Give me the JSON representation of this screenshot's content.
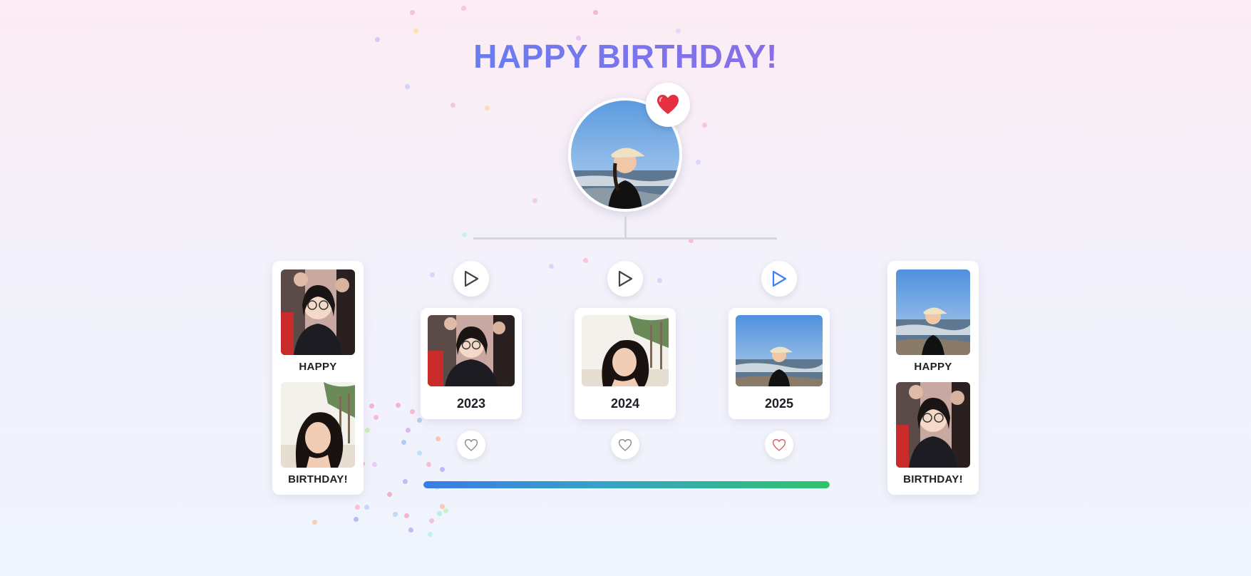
{
  "title": "HAPPY BIRTHDAY!",
  "colors": {
    "title_start": "#6a7cf0",
    "title_end": "#8a6ee6",
    "heart": "#e53040",
    "progress_start": "#3a7be8",
    "progress_end": "#2fc46a",
    "like_active": "#d9606a",
    "like_inactive": "#8a8a94",
    "play_active": "#3b82f6",
    "play_inactive": "#444"
  },
  "profile": {
    "avatar": "profile-photo",
    "badge_icon": "heart-icon"
  },
  "left_strip": {
    "captions": [
      "HAPPY",
      "BIRTHDAY!"
    ]
  },
  "right_strip": {
    "captions": [
      "HAPPY",
      "BIRTHDAY!"
    ]
  },
  "timeline": {
    "items": [
      {
        "year": "2023",
        "play_icon": "play-icon",
        "like_icon": "heart-outline-icon",
        "liked": false,
        "playing": false
      },
      {
        "year": "2024",
        "play_icon": "play-icon",
        "like_icon": "heart-outline-icon",
        "liked": false,
        "playing": false
      },
      {
        "year": "2025",
        "play_icon": "play-icon",
        "like_icon": "heart-outline-icon",
        "liked": true,
        "playing": true
      }
    ]
  },
  "progress": {
    "value": 1.0
  }
}
